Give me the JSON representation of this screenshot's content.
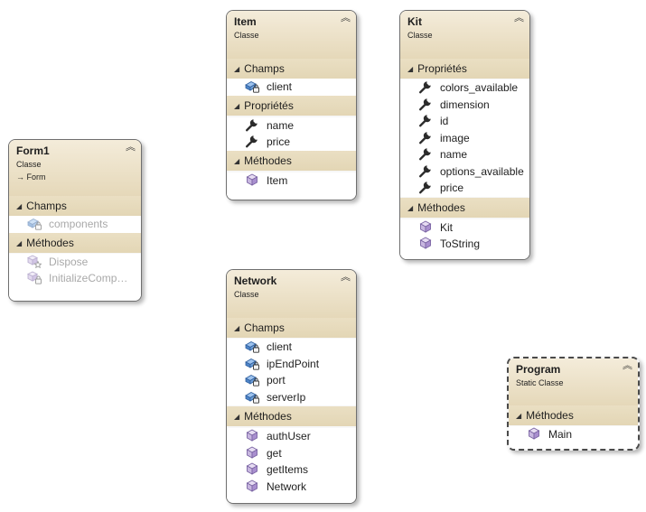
{
  "form1": {
    "name": "Form1",
    "stereotype": "Classe",
    "base": "Form",
    "sections": {
      "fields": "Champs",
      "methods": "Méthodes"
    },
    "fields": [
      "components"
    ],
    "methods": [
      "Dispose",
      "InitializeComponent"
    ]
  },
  "item": {
    "name": "Item",
    "stereotype": "Classe",
    "sections": {
      "fields": "Champs",
      "properties": "Propriétés",
      "methods": "Méthodes"
    },
    "fields": [
      "client"
    ],
    "properties": [
      "name",
      "price"
    ],
    "methods": [
      "Item"
    ]
  },
  "kit": {
    "name": "Kit",
    "stereotype": "Classe",
    "sections": {
      "properties": "Propriétés",
      "methods": "Méthodes"
    },
    "properties": [
      "colors_available",
      "dimension",
      "id",
      "image",
      "name",
      "options_available",
      "price"
    ],
    "methods": [
      "Kit",
      "ToString"
    ]
  },
  "network": {
    "name": "Network",
    "stereotype": "Classe",
    "sections": {
      "fields": "Champs",
      "methods": "Méthodes"
    },
    "fields": [
      "client",
      "ipEndPoint",
      "port",
      "serverIp"
    ],
    "methods": [
      "authUser",
      "get",
      "getItems",
      "Network"
    ]
  },
  "program": {
    "name": "Program",
    "stereotype": "Static Classe",
    "sections": {
      "methods": "Méthodes"
    },
    "methods": [
      "Main"
    ]
  },
  "icons": {
    "field": "private-field-icon",
    "property": "wrench-property-icon",
    "method": "method-cube-icon",
    "protected_method": "protected-method-icon",
    "private_method": "private-method-icon",
    "collapse": "collapse-chevron-icon",
    "section": "expanded-triangle-icon"
  },
  "colors": {
    "header_light": "#f4ecda",
    "header_dark": "#e5d8b9",
    "field_blue": "#3b6fb5",
    "method_purple": "#8a6fb0"
  }
}
